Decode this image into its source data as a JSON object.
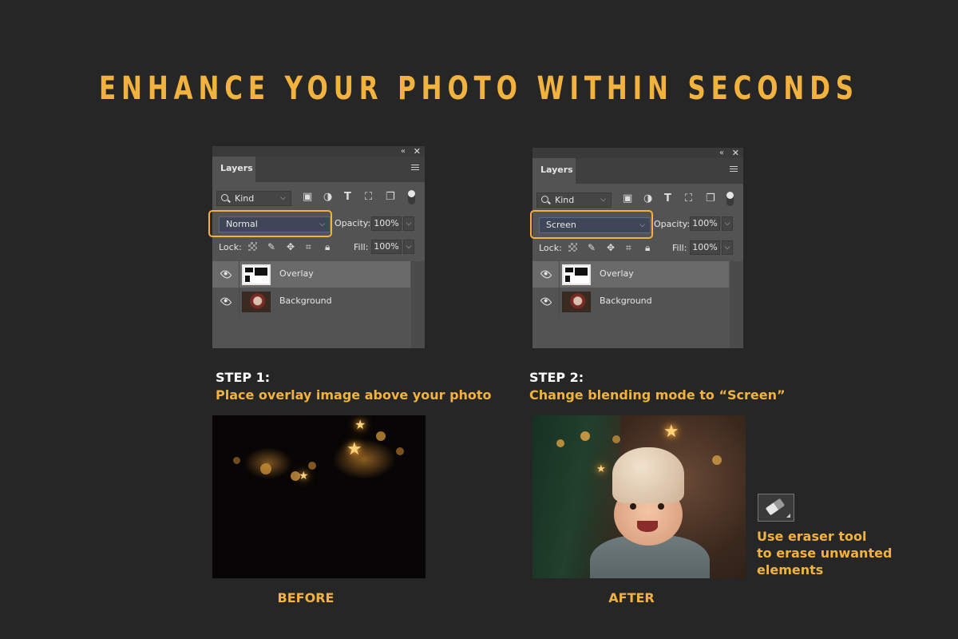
{
  "title": "ENHANCE YOUR PHOTO WITHIN SECONDS",
  "panels": [
    {
      "tab": "Layers",
      "filter": "Kind",
      "blend_mode": "Normal",
      "opacity_label": "Opacity:",
      "opacity": "100%",
      "lock_label": "Lock:",
      "fill_label": "Fill:",
      "fill": "100%",
      "layers": [
        {
          "name": "Overlay",
          "thumb_icon": "overlay-thumbnail",
          "selected": true
        },
        {
          "name": "Background",
          "thumb_icon": "photo-thumbnail",
          "selected": false
        }
      ]
    },
    {
      "tab": "Layers",
      "filter": "Kind",
      "blend_mode": "Screen",
      "opacity_label": "Opacity:",
      "opacity": "100%",
      "lock_label": "Lock:",
      "fill_label": "Fill:",
      "fill": "100%",
      "layers": [
        {
          "name": "Overlay",
          "thumb_icon": "overlay-thumbnail",
          "selected": true
        },
        {
          "name": "Background",
          "thumb_icon": "photo-thumbnail",
          "selected": false
        }
      ]
    }
  ],
  "steps": [
    {
      "heading": "STEP 1:",
      "text": "Place overlay image above your photo",
      "caption": "BEFORE"
    },
    {
      "heading": "STEP 2:",
      "text": "Change blending mode to “Screen”",
      "caption": "AFTER"
    }
  ],
  "eraser_note": [
    "Use eraser tool",
    "to erase unwanted",
    "elements"
  ],
  "icons": {
    "collapse": "«",
    "close": "✕",
    "chevron": "⌵",
    "filters": [
      "image-icon",
      "adjustment-icon",
      "type-icon",
      "shape-icon",
      "smart-object-icon"
    ],
    "locks": [
      "lock-transparent-icon",
      "lock-paint-icon",
      "lock-position-icon",
      "lock-artboard-icon",
      "lock-all-icon"
    ],
    "eraser": "eraser-icon"
  },
  "colors": {
    "accent": "#f2b23e",
    "background": "#262626",
    "panel": "#535353"
  }
}
